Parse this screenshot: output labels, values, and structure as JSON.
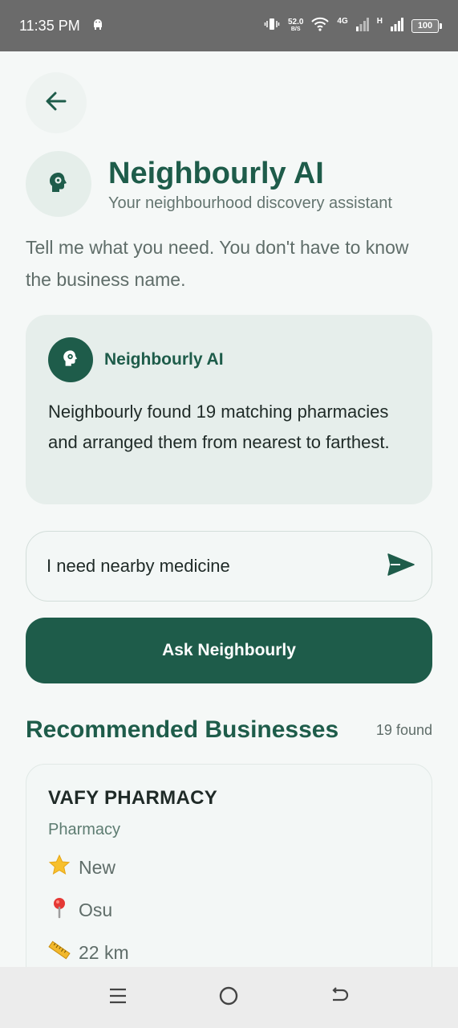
{
  "status_bar": {
    "time": "11:35 PM",
    "speed_value": "52.0",
    "speed_unit": "B/S",
    "network_4g": "4G",
    "network_h": "H",
    "battery": "100"
  },
  "header": {
    "title": "Neighbourly AI",
    "subtitle": "Your neighbourhood discovery assistant",
    "intro": "Tell me what you need. You don't have to know the business name."
  },
  "ai_card": {
    "name": "Neighbourly AI",
    "message": "Neighbourly found 19 matching pharmacies and arranged them from nearest to farthest."
  },
  "query": {
    "value": "I need nearby medicine",
    "placeholder": ""
  },
  "ask_button": "Ask Neighbourly",
  "results": {
    "title": "Recommended Businesses",
    "count": "19 found",
    "items": [
      {
        "name": "VAFY PHARMACY",
        "category": "Pharmacy",
        "rating": "New",
        "location": "Osu",
        "distance": "22 km"
      }
    ]
  },
  "icons": {
    "back": "arrow-left-icon",
    "assistant": "head-gear-icon",
    "send": "send-icon",
    "rating": "star-icon",
    "location": "pin-icon",
    "distance": "ruler-icon"
  },
  "colors": {
    "primary": "#1e5c4a",
    "background": "#f5f8f7",
    "card": "#e6eeeb"
  }
}
